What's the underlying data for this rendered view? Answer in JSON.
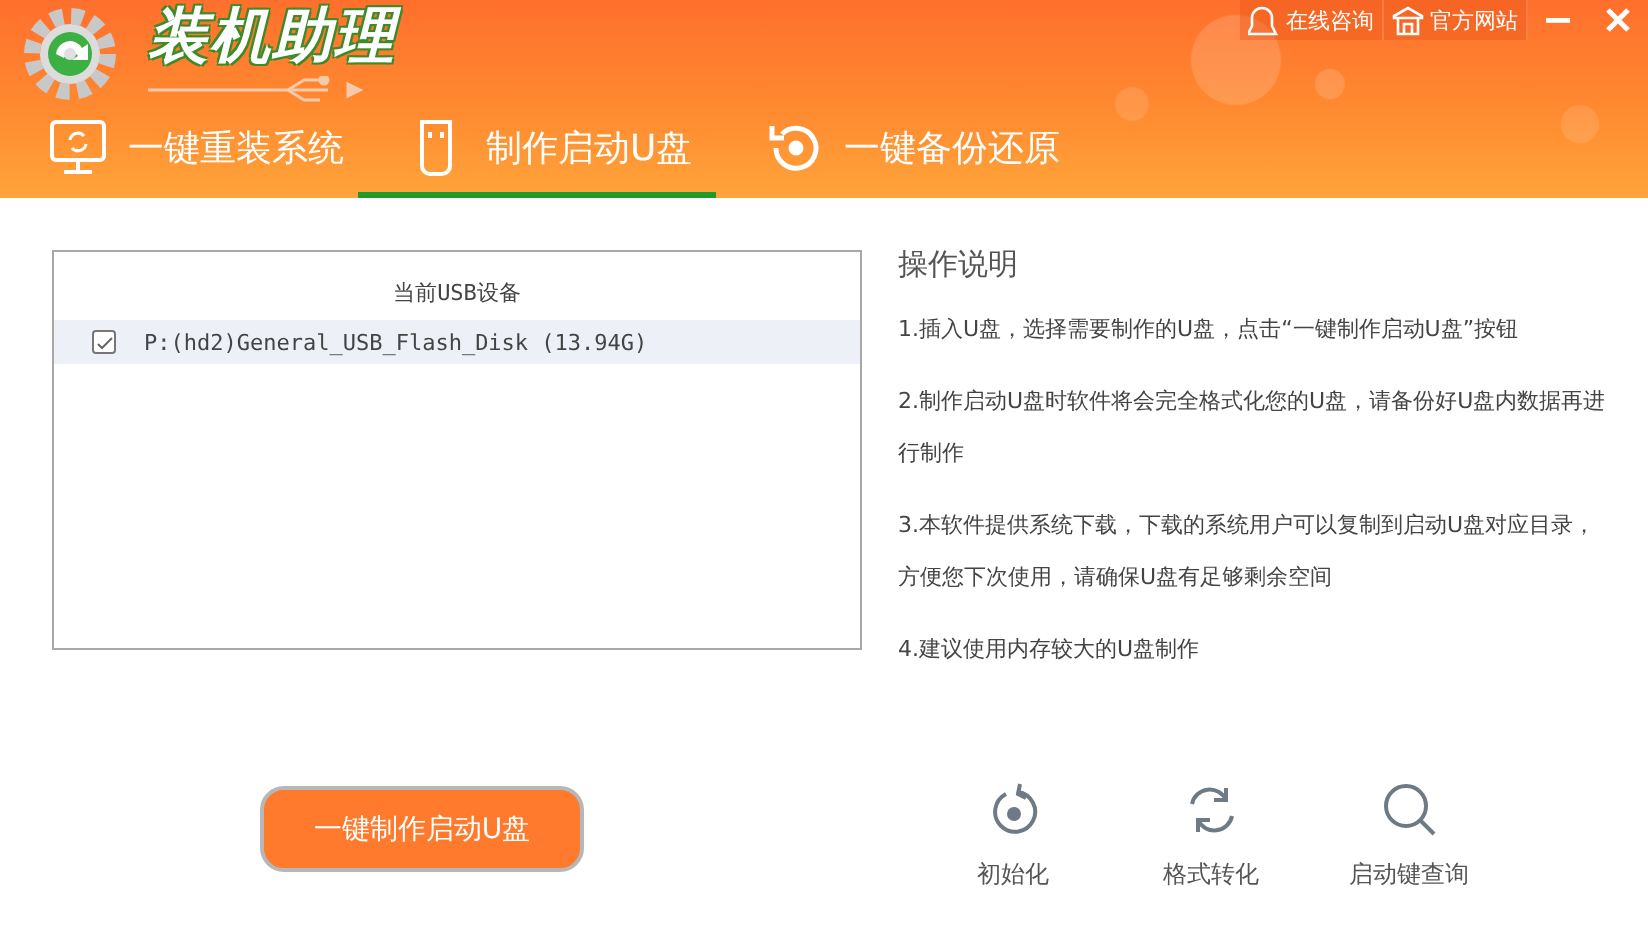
{
  "app": {
    "title": "装机助理"
  },
  "top_links": [
    {
      "label": "在线咨询"
    },
    {
      "label": "官方网站"
    }
  ],
  "tabs": [
    {
      "label": "一键重装系统",
      "selected": false
    },
    {
      "label": "制作启动U盘",
      "selected": true
    },
    {
      "label": "一键备份还原",
      "selected": false
    }
  ],
  "device_list": {
    "header": "当前USB设备",
    "items": [
      {
        "label": "P:(hd2)General_USB_Flash_Disk (13.94G)",
        "checked": true,
        "selected": true
      }
    ]
  },
  "instructions": {
    "title": "操作说明",
    "steps": [
      "1.插入U盘，选择需要制作的U盘，点击“一键制作启动U盘”按钮",
      "2.制作启动U盘时软件将会完全格式化您的U盘，请备份好U盘内数据再进行制作",
      "3.本软件提供系统下载，下载的系统用户可以复制到启动U盘对应目录，方便您下次使用，请确保U盘有足够剩余空间",
      "4.建议使用内存较大的U盘制作"
    ]
  },
  "primary_button": {
    "label": "一键制作启动U盘"
  },
  "tools": [
    {
      "label": "初始化"
    },
    {
      "label": "格式转化"
    },
    {
      "label": "启动键查询"
    }
  ]
}
